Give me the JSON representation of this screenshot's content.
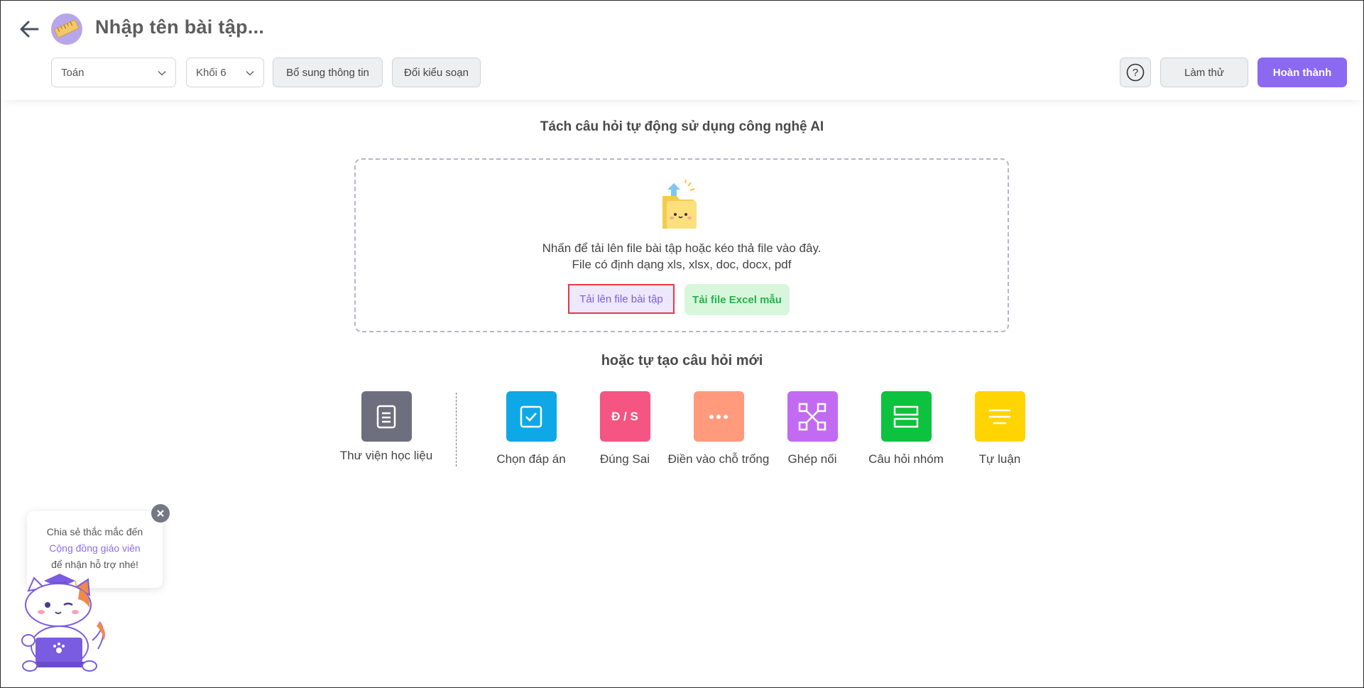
{
  "header": {
    "title": "Nhập tên bài tập...",
    "subject_select": "Toán",
    "grade_select": "Khối 6",
    "more_info_label": "Bổ sung thông tin",
    "change_mode_label": "Đổi kiểu soạn",
    "help_label": "?",
    "try_label": "Làm thử",
    "done_label": "Hoàn thành"
  },
  "ai_section": {
    "heading": "Tách câu hỏi tự động sử dụng công nghệ AI",
    "instruction_line1": "Nhấn để tải lên file bài tập hoặc kéo thả file vào đây.",
    "instruction_line2": "File có định dạng xls, xlsx, doc, docx, pdf",
    "upload_label": "Tải lên file bài tập",
    "excel_template_label": "Tải file Excel mẫu"
  },
  "create_section": {
    "heading": "hoặc tự tạo câu hỏi mới",
    "library_label": "Thư viện học liệu",
    "types": [
      {
        "label": "Chọn đáp án",
        "icon": "checkbox-icon",
        "color": "#0fa8e6"
      },
      {
        "label": "Đúng Sai",
        "icon": "true-false-icon",
        "color": "#f45582",
        "icon_text": "Đ / S"
      },
      {
        "label": "Điền vào chỗ trống",
        "icon": "dots-icon",
        "color": "#ff9a7d"
      },
      {
        "label": "Ghép nối",
        "icon": "matching-icon",
        "color": "#c26bf2"
      },
      {
        "label": "Câu hỏi nhóm",
        "icon": "group-icon",
        "color": "#0dc23e"
      },
      {
        "label": "Tự luận",
        "icon": "essay-icon",
        "color": "#ffd400"
      }
    ]
  },
  "support": {
    "line1": "Chia sẻ thắc mắc đến",
    "link": "Cộng đồng giáo viên",
    "line3": "để nhận hỗ trợ nhé!"
  },
  "colors": {
    "accent": "#8b69f0",
    "upload_bg": "#eee8fd",
    "excel_green": "#26b24b",
    "highlight_border": "#e63946"
  }
}
